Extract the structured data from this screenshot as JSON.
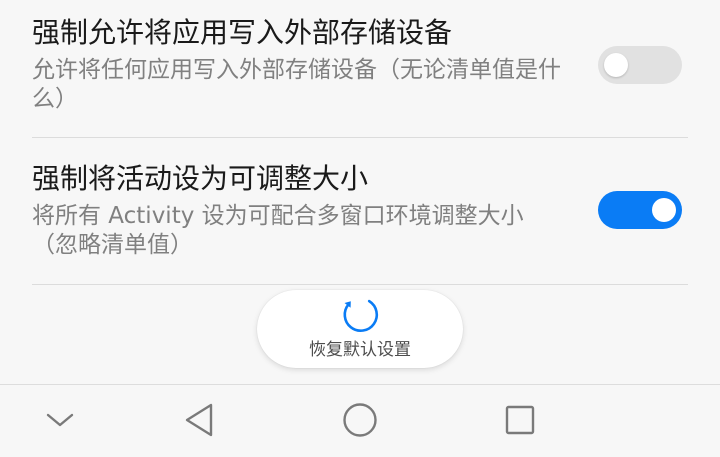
{
  "settings": [
    {
      "title": "强制允许将应用写入外部存储设备",
      "description": "允许将任何应用写入外部存储设备（无论清单值是什么）",
      "enabled": false
    },
    {
      "title": "强制将活动设为可调整大小",
      "description": "将所有 Activity 设为可配合多窗口环境调整大小（忽略清单值）",
      "enabled": true
    }
  ],
  "reset": {
    "label": "恢复默认设置",
    "icon": "refresh-icon"
  },
  "nav_bar": {
    "icons": [
      "chevron-down-icon",
      "back-triangle-icon",
      "home-circle-icon",
      "recents-square-icon"
    ]
  },
  "colors": {
    "accent": "#0a7cf5",
    "switch_off": "#e1e1e1",
    "background": "#f7f7f7",
    "title_text": "#1a1a1a",
    "desc_text": "#808080"
  }
}
